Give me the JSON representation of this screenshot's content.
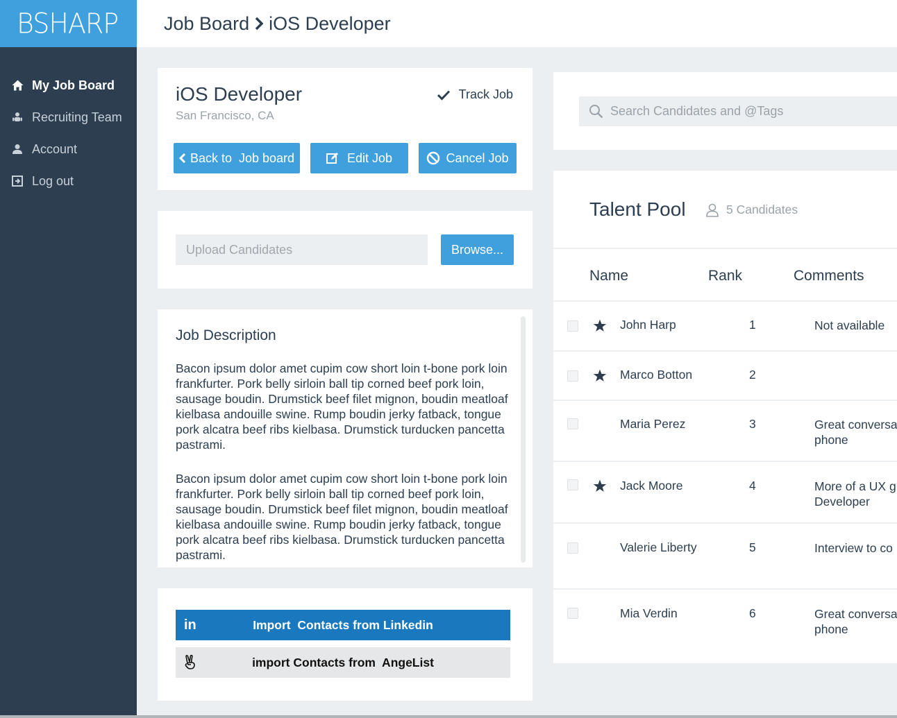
{
  "app": {
    "logo": "BSHARP"
  },
  "sidebar": {
    "items": [
      {
        "label": "My Job Board",
        "icon": "home-icon",
        "active": true
      },
      {
        "label": "Recruiting Team",
        "icon": "team-icon"
      },
      {
        "label": "Account",
        "icon": "user-icon"
      },
      {
        "label": "Log out",
        "icon": "logout-icon"
      }
    ]
  },
  "header": {
    "crumb_root": "Job Board",
    "crumb_current": "iOS Developer"
  },
  "job": {
    "title": "iOS Developer",
    "location": "San Francisco, CA",
    "track_label": "Track Job",
    "back_label": "Back to  Job board",
    "edit_label": "Edit Job",
    "cancel_label": "Cancel Job"
  },
  "upload": {
    "placeholder": "Upload Candidates",
    "browse_label": "Browse..."
  },
  "description": {
    "title": "Job Description",
    "paragraphs": [
      "Bacon ipsum dolor amet cupim cow short loin t-bone pork loin frankfurter. Pork belly sirloin ball tip corned beef pork loin, sausage boudin. Drumstick beef filet mignon, boudin meatloaf kielbasa andouille swine. Rump boudin jerky fatback, tongue pork alcatra beef ribs kielbasa. Drumstick turducken pancetta pastrami.",
      "Bacon ipsum dolor amet cupim cow short loin t-bone pork loin frankfurter. Pork belly sirloin ball tip corned beef pork loin, sausage boudin. Drumstick beef filet mignon, boudin meatloaf kielbasa andouille swine. Rump boudin jerky fatback, tongue pork alcatra beef ribs kielbasa. Drumstick turducken pancetta pastrami."
    ]
  },
  "imports": {
    "linkedin_label": "Import  Contacts from Linkedin",
    "linkedin_icon_text": "in",
    "angellist_label": "import Contacts from  AngeList"
  },
  "search": {
    "placeholder": "Search Candidates and @Tags"
  },
  "pool": {
    "title": "Talent Pool",
    "count": "5 Candidates",
    "columns": {
      "name": "Name",
      "rank": "Rank",
      "comments": "Comments"
    },
    "candidates": [
      {
        "name": "John Harp",
        "rank": "1",
        "comment": "Not available",
        "starred": true
      },
      {
        "name": "Marco Botton",
        "rank": "2",
        "comment": "",
        "starred": true
      },
      {
        "name": "Maria Perez",
        "rank": "3",
        "comment": "Great conversa phone",
        "starred": false
      },
      {
        "name": "Jack Moore",
        "rank": "4",
        "comment": "More of a UX gu Developer",
        "starred": true
      },
      {
        "name": "Valerie Liberty",
        "rank": "5",
        "comment": "Interview to co",
        "starred": false
      },
      {
        "name": "Mia Verdin",
        "rank": "6",
        "comment": "Great conversa phone",
        "starred": false
      }
    ]
  },
  "colors": {
    "primary": "#3fa0dd",
    "sidebar": "#2c3e50",
    "linkedin": "#1a79be",
    "background": "#eceff1"
  }
}
